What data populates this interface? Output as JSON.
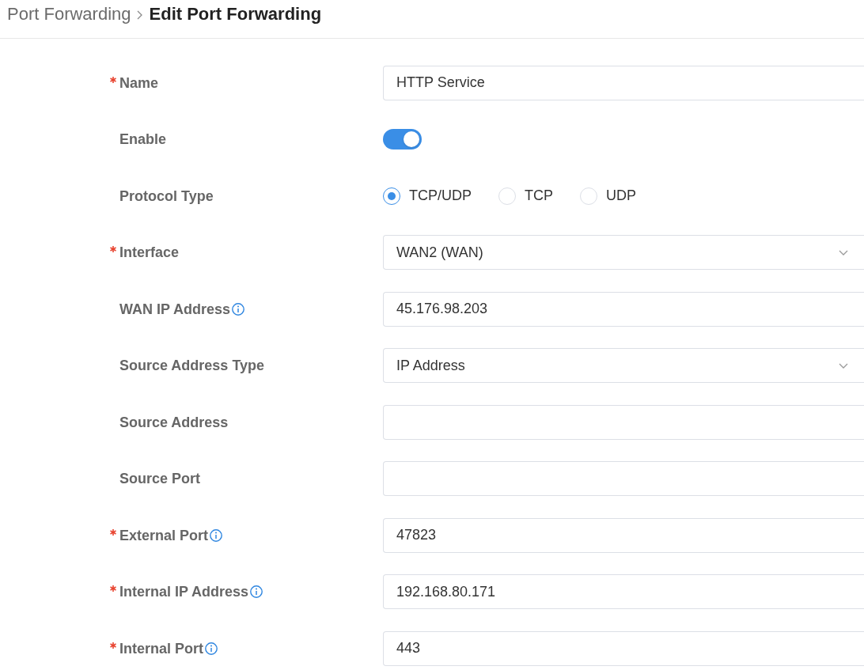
{
  "breadcrumb": {
    "parent": "Port Forwarding",
    "current": "Edit Port Forwarding"
  },
  "fields": [
    {
      "label": "Name",
      "required": true,
      "info": false,
      "kind": "text",
      "value": "HTTP Service"
    },
    {
      "label": "Enable",
      "required": false,
      "info": false,
      "kind": "switch",
      "on": true
    },
    {
      "label": "Protocol Type",
      "required": false,
      "info": false,
      "kind": "radio",
      "options": [
        {
          "label": "TCP/UDP",
          "selected": true
        },
        {
          "label": "TCP",
          "selected": false
        },
        {
          "label": "UDP",
          "selected": false
        }
      ]
    },
    {
      "label": "Interface",
      "required": true,
      "info": false,
      "kind": "select",
      "value": "WAN2 (WAN)"
    },
    {
      "label": "WAN IP Address",
      "required": false,
      "info": true,
      "kind": "text",
      "value": "45.176.98.203"
    },
    {
      "label": "Source Address Type",
      "required": false,
      "info": false,
      "kind": "select",
      "value": "IP Address"
    },
    {
      "label": "Source Address",
      "required": false,
      "info": false,
      "kind": "text"
    },
    {
      "label": "Source Port",
      "required": false,
      "info": false,
      "kind": "text"
    },
    {
      "label": "External Port",
      "required": true,
      "info": true,
      "kind": "text",
      "value": "47823"
    },
    {
      "label": "Internal IP Address",
      "required": true,
      "info": true,
      "kind": "text",
      "value": "192.168.80.171"
    },
    {
      "label": "Internal Port",
      "required": true,
      "info": true,
      "kind": "text",
      "value": "443"
    }
  ]
}
